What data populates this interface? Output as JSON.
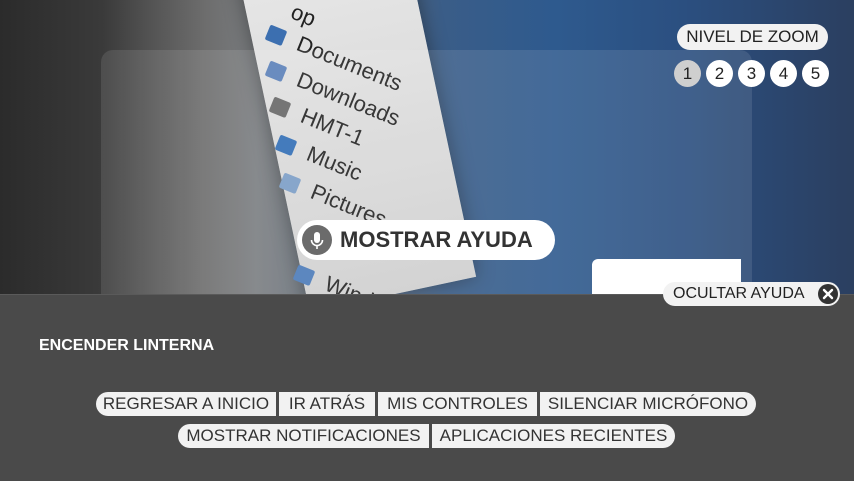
{
  "zoom": {
    "label": "NIVEL DE ZOOM",
    "levels": [
      "1",
      "2",
      "3",
      "4",
      "5"
    ],
    "selected": "1"
  },
  "camera": {
    "files": [
      "Documents",
      "Downloads",
      "HMT-1",
      "Music",
      "Pictures",
      "Windows"
    ],
    "partial_top": "op"
  },
  "help": {
    "show_label": "MOSTRAR AYUDA",
    "hide_label": "OCULTAR AYUDA"
  },
  "panel": {
    "torch": "ENCENDER LINTERNA",
    "row1": [
      "REGRESAR A INICIO",
      "IR ATRÁS",
      "MIS CONTROLES",
      "SILENCIAR MICRÓFONO"
    ],
    "row2": [
      "MOSTRAR NOTIFICACIONES",
      "APLICACIONES RECIENTES"
    ]
  },
  "colors": {
    "panel_bg": "#4a4a4a",
    "chip_bg": "#f2f2f2",
    "screen_blue": "#2e5a8e"
  }
}
